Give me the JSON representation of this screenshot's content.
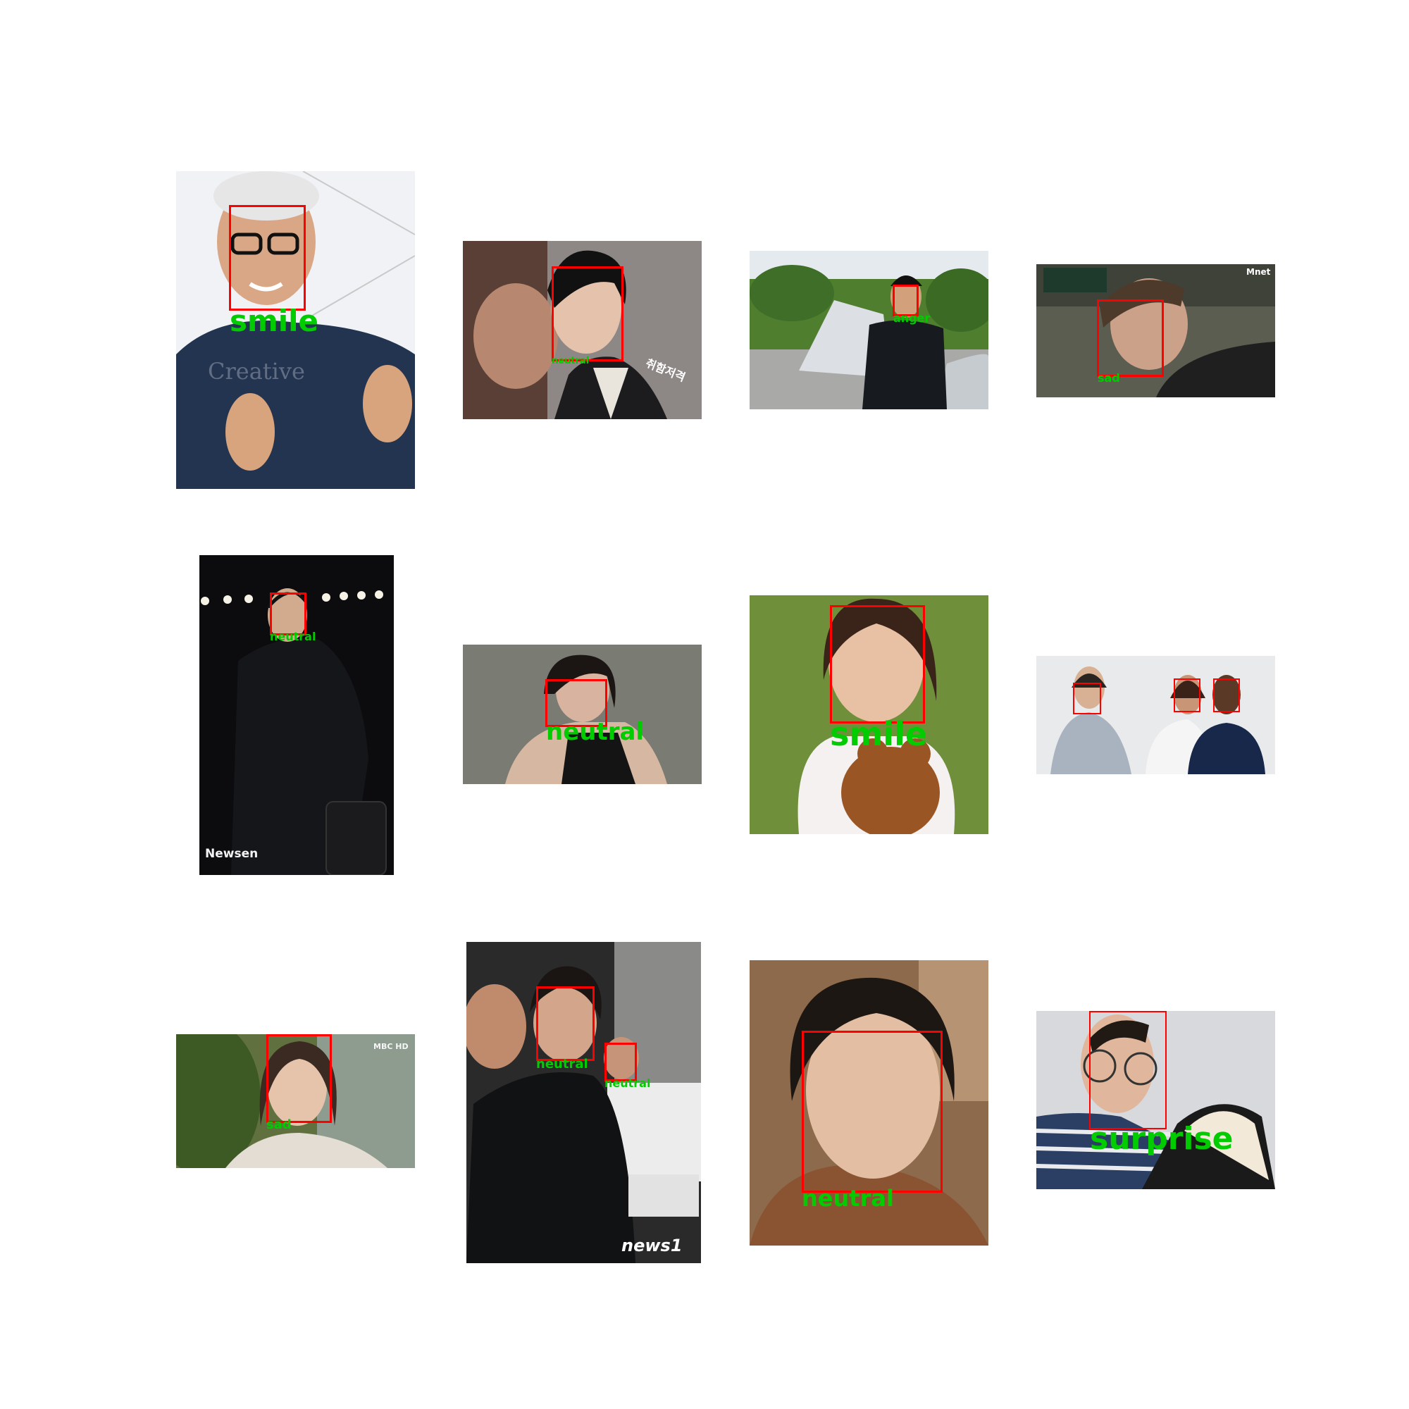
{
  "colors": {
    "box": "#ff0000",
    "label": "#00cc00",
    "background": "#ffffff"
  },
  "panels": [
    {
      "labels": [
        "smile"
      ],
      "watermark": ""
    },
    {
      "labels": [
        "neutral"
      ],
      "watermark": "취함저격"
    },
    {
      "labels": [
        "anger"
      ],
      "watermark": ""
    },
    {
      "labels": [
        "sad"
      ],
      "watermark": "Mnet"
    },
    {
      "labels": [
        "neutral"
      ],
      "watermark": "Newsen"
    },
    {
      "labels": [
        "neutral"
      ],
      "watermark": ""
    },
    {
      "labels": [
        "smile"
      ],
      "watermark": ""
    },
    {
      "labels": [
        "",
        "",
        ""
      ],
      "watermark": ""
    },
    {
      "labels": [
        "sad"
      ],
      "watermark": "MBC HD"
    },
    {
      "labels": [
        "neutral",
        "neutral"
      ],
      "watermark": "news1"
    },
    {
      "labels": [
        "neutral"
      ],
      "watermark": ""
    },
    {
      "labels": [
        "surprise"
      ],
      "watermark": ""
    }
  ]
}
